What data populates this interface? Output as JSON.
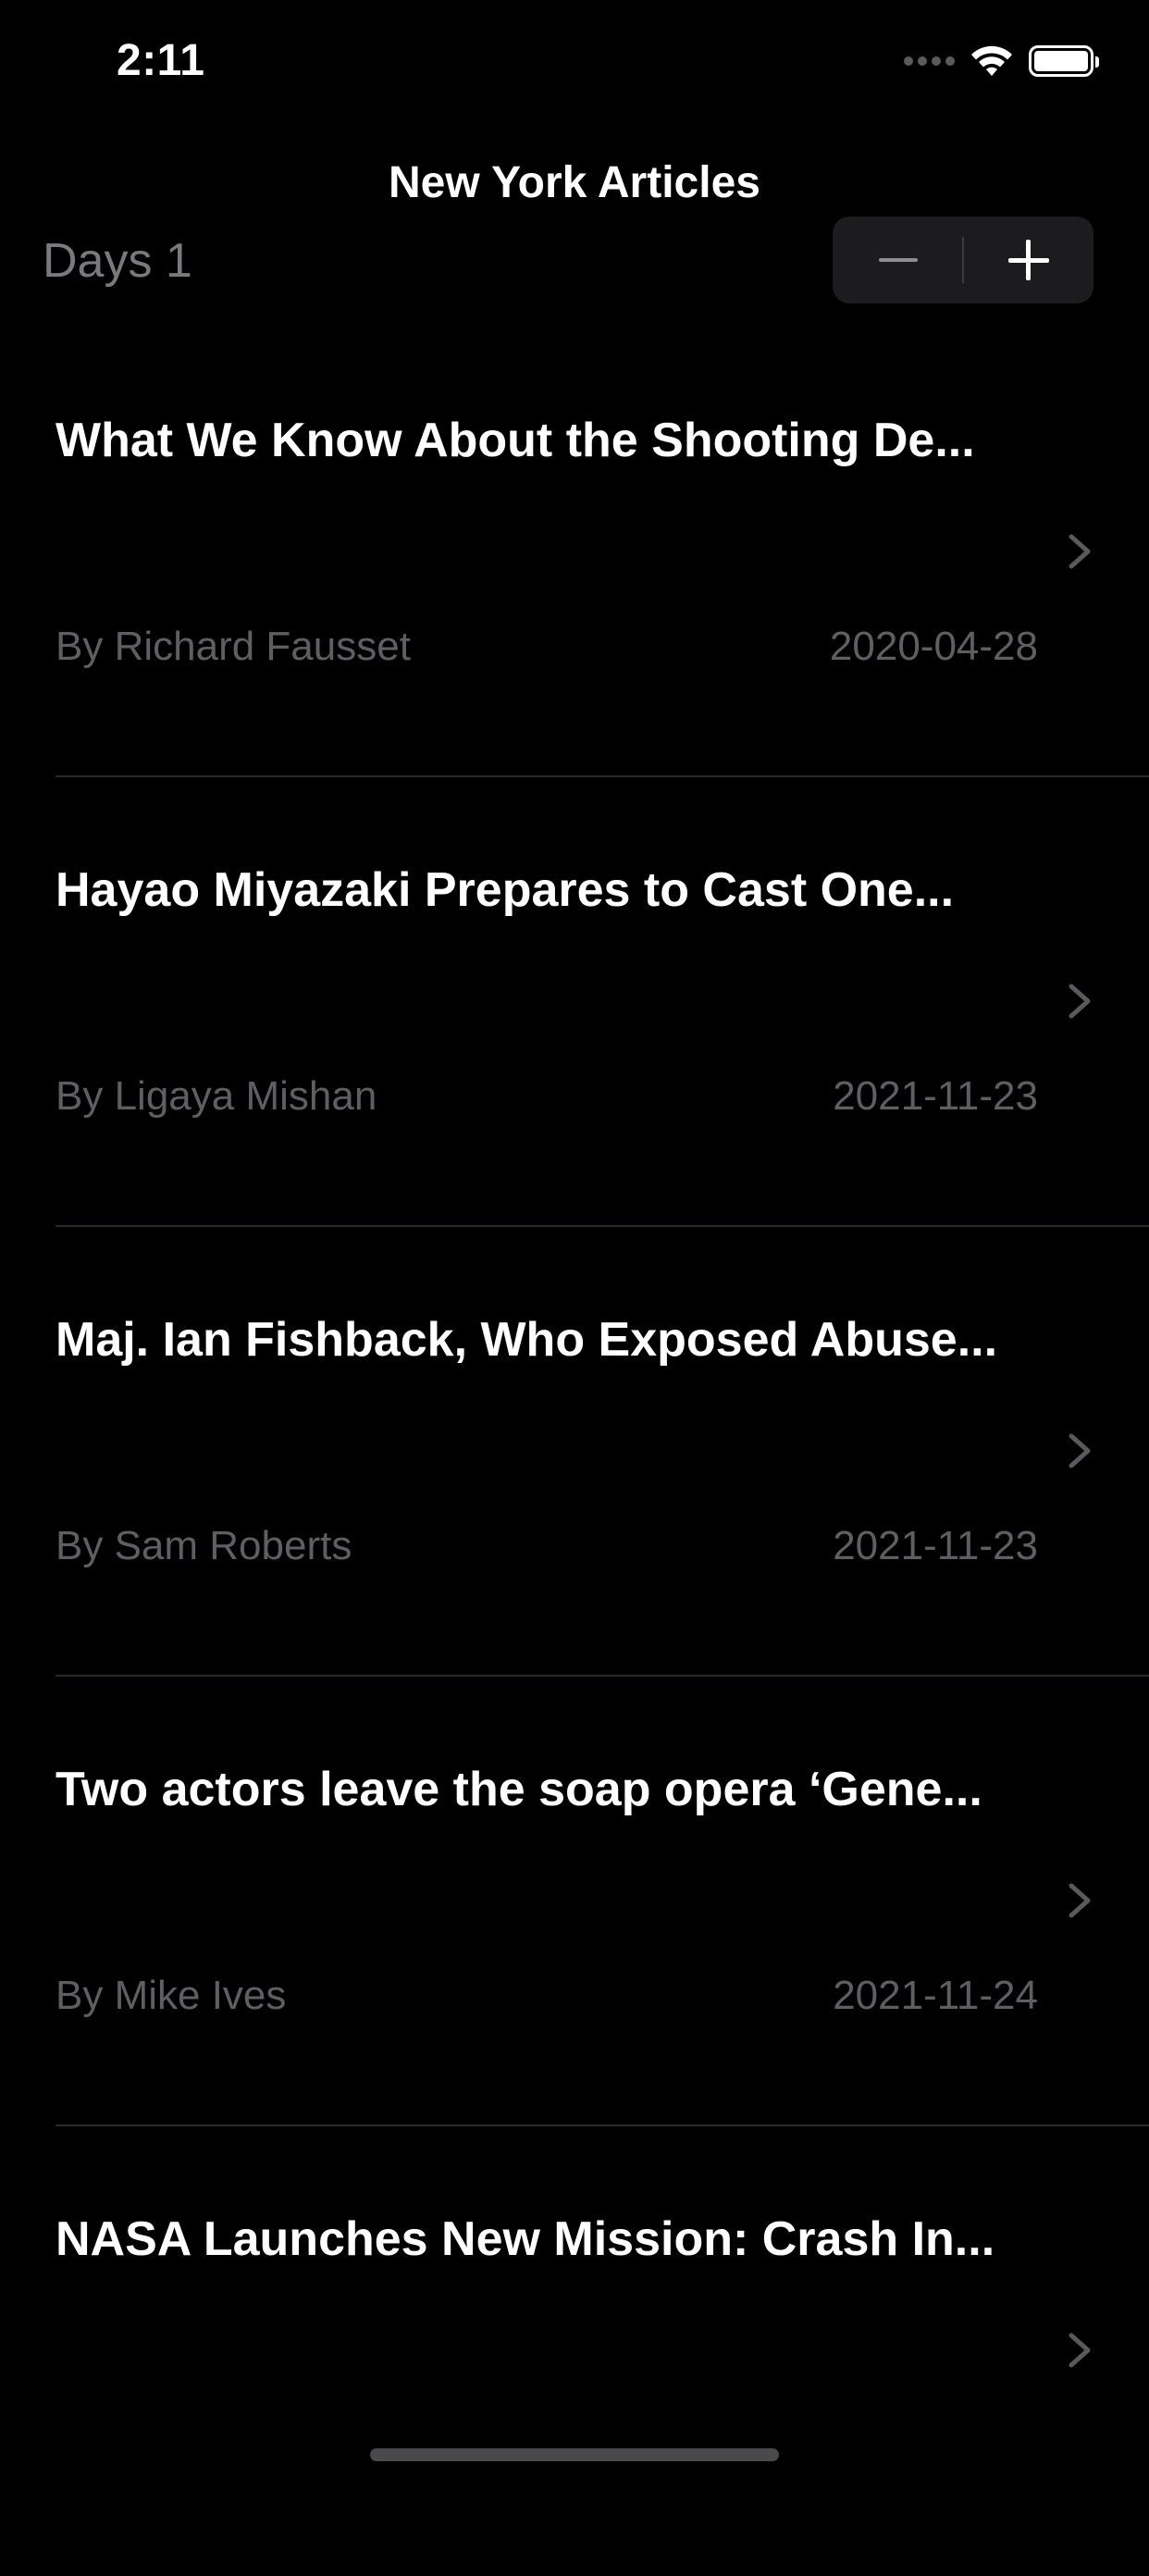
{
  "status_bar": {
    "time": "2:11",
    "signal_icon": "signal-dots-icon",
    "wifi_icon": "wifi-icon",
    "battery_icon": "battery-icon"
  },
  "nav": {
    "title": "New York Articles"
  },
  "controls": {
    "days_label": "Days 1",
    "stepper": {
      "decrement_icon": "minus-icon",
      "increment_icon": "plus-icon"
    }
  },
  "articles": [
    {
      "title": "What We Know About the Shooting De...",
      "author": "By Richard Fausset",
      "date": "2020-04-28"
    },
    {
      "title": "Hayao Miyazaki Prepares to Cast One...",
      "author": "By Ligaya Mishan",
      "date": "2021-11-23"
    },
    {
      "title": "Maj. Ian Fishback, Who Exposed Abuse...",
      "author": "By Sam Roberts",
      "date": "2021-11-23"
    },
    {
      "title": "Two actors leave the soap opera ‘Gene...",
      "author": "By Mike Ives",
      "date": "2021-11-24"
    },
    {
      "title": "NASA Launches New Mission: Crash In...",
      "author": "",
      "date": ""
    }
  ],
  "colors": {
    "background": "#000000",
    "secondary_text": "#5f5f63",
    "stepper_bg": "#1c1c1e"
  }
}
